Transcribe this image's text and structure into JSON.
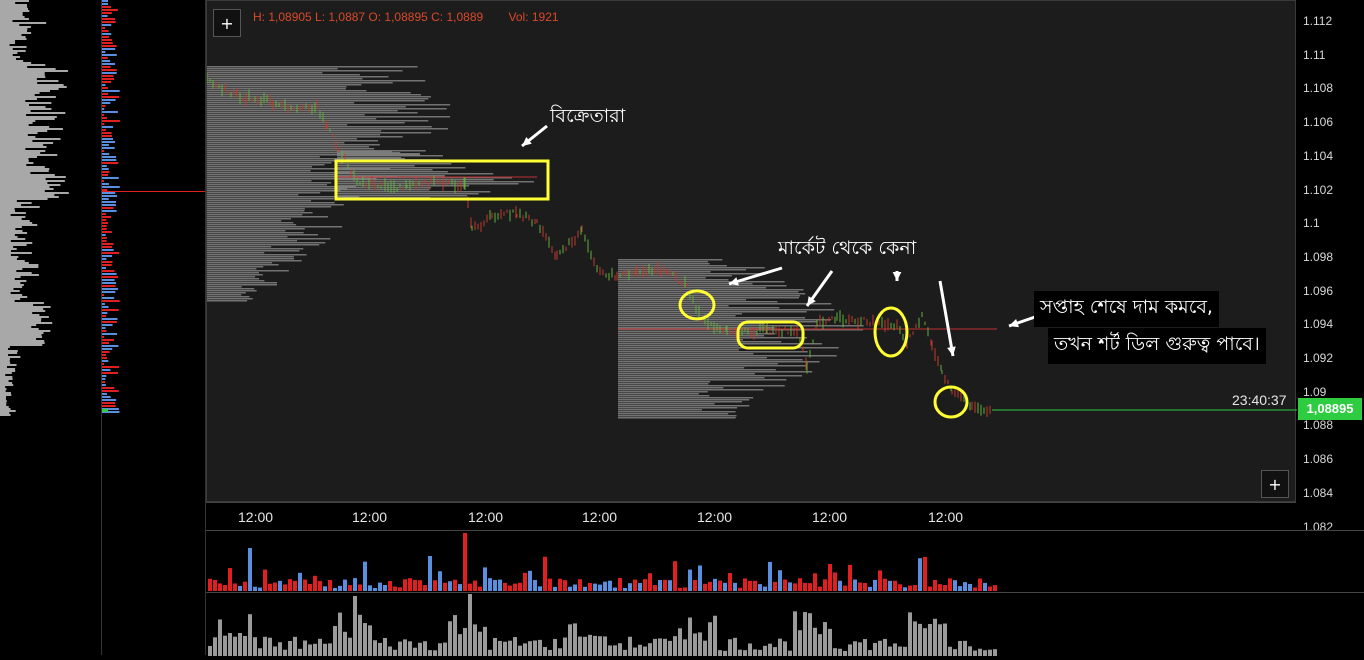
{
  "colors": {
    "up": "#5a8fe0",
    "down": "#e02020",
    "profile": "#a0a0a0",
    "highlight": "#ffff33",
    "last_price": "#2ecc40",
    "ohlc_text": "#d94a2a"
  },
  "ohlc": {
    "text": "H: 1,08905 L: 1,0887 O: 1,08895 C: 1,0889",
    "vol": "Vol: 1921"
  },
  "buttons": {
    "add_top": "+",
    "add_bottom": "+"
  },
  "price_axis": {
    "ticks": [
      "1.112",
      "1.11",
      "1.108",
      "1.106",
      "1.104",
      "1.102",
      "1.1",
      "1.098",
      "1.096",
      "1.094",
      "1.092",
      "1.09",
      "1.088",
      "1.086",
      "1.084",
      "1.082"
    ],
    "last_price": "1,08895",
    "timer": "23:40:37"
  },
  "time_axis": {
    "labels": [
      "12:00",
      "12:00",
      "12:00",
      "12:00",
      "12:00",
      "12:00",
      "12:00"
    ]
  },
  "annotations": {
    "sellers": "বিক্রেতারা",
    "market_buy": "মার্কেট থেকে কেনা",
    "note_line1": "সপ্তাহ শেষে দাম কমবে,",
    "note_line2": "তখন শর্ট ডিল গুরুত্ব পাবে।"
  }
}
